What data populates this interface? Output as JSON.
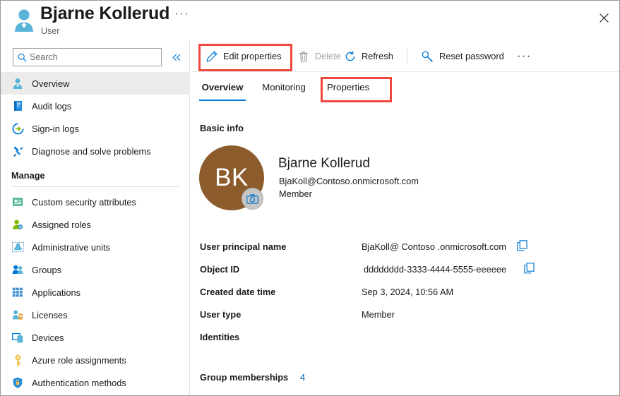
{
  "header": {
    "title": "Bjarne Kollerud",
    "subtitle": "User",
    "ellipsis": "···",
    "close_icon": "close-icon",
    "user_icon": "user-icon"
  },
  "sidebar": {
    "search": {
      "placeholder": "Search",
      "value": "",
      "icon": "search-icon"
    },
    "collapse_icon": "chevron-double-left-icon",
    "items": [
      {
        "label": "Overview",
        "icon": "user-icon",
        "selected": true
      },
      {
        "label": "Audit logs",
        "icon": "audit-log-icon",
        "selected": false
      },
      {
        "label": "Sign-in logs",
        "icon": "sign-in-icon",
        "selected": false
      },
      {
        "label": "Diagnose and solve problems",
        "icon": "diagnose-icon",
        "selected": false
      }
    ],
    "manage_section": {
      "title": "Manage",
      "items": [
        {
          "label": "Custom security attributes",
          "icon": "custom-security-attributes-icon"
        },
        {
          "label": "Assigned roles",
          "icon": "assigned-roles-icon"
        },
        {
          "label": "Administrative units",
          "icon": "administrative-units-icon"
        },
        {
          "label": "Groups",
          "icon": "groups-icon"
        },
        {
          "label": "Applications",
          "icon": "applications-icon"
        },
        {
          "label": "Licenses",
          "icon": "licenses-icon"
        },
        {
          "label": "Devices",
          "icon": "devices-icon"
        },
        {
          "label": "Azure role assignments",
          "icon": "key-icon"
        },
        {
          "label": "Authentication methods",
          "icon": "shield-lock-icon"
        }
      ]
    }
  },
  "command_bar": {
    "buttons": [
      {
        "label": "Edit properties",
        "icon": "pencil-icon",
        "disabled": false
      },
      {
        "label": "Delete",
        "icon": "trash-icon",
        "disabled": true
      },
      {
        "label": "Refresh",
        "icon": "refresh-icon",
        "disabled": false
      },
      {
        "label": "Reset password",
        "icon": "key-search-icon",
        "disabled": false
      }
    ],
    "overflow": "···"
  },
  "tabs": [
    {
      "label": "Overview",
      "active": true
    },
    {
      "label": "Monitoring",
      "active": false
    },
    {
      "label": "Properties",
      "active": false
    }
  ],
  "content": {
    "section_title": "Basic info",
    "avatar": {
      "initials": "BK",
      "color": "#8c5c2c",
      "camera_icon": "camera-icon"
    },
    "identity": {
      "name": "Bjarne Kollerud",
      "upn": "BjaKoll@Contoso.onmicrosoft.com",
      "user_type": "Member"
    },
    "properties": [
      {
        "label": "User principal name",
        "value": "BjaKoll@ Contoso .onmicrosoft.com",
        "copy": true
      },
      {
        "label": "Object ID",
        "value": "dddddddd-3333-4444-5555-eeeeee",
        "copy": true
      },
      {
        "label": "Created date time",
        "value": "Sep 3, 2024, 10:56 AM",
        "copy": false
      },
      {
        "label": "User type",
        "value": "Member",
        "copy": false
      },
      {
        "label": "Identities",
        "value": "",
        "copy": false
      }
    ],
    "group_memberships": {
      "label": "Group memberships",
      "count": "4"
    }
  },
  "annotations": {
    "accent_color": "#f0483e",
    "highlighted": [
      "Edit properties",
      "Properties"
    ]
  }
}
